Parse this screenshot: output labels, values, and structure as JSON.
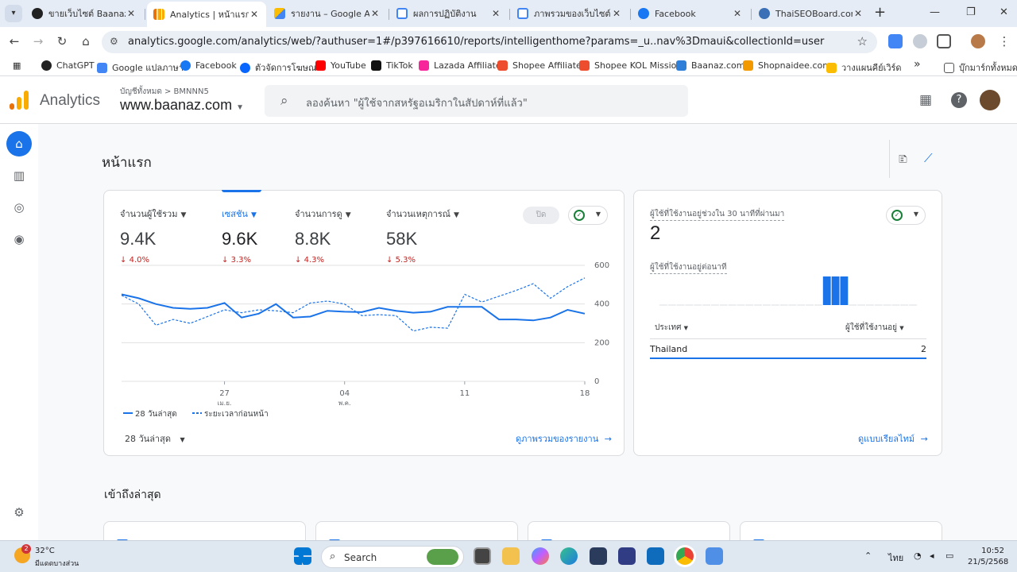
{
  "browser": {
    "tabs": [
      {
        "title": "ขายเว็บไซต์ Baanaz.com",
        "favicon_color": "#222222"
      },
      {
        "title": "Analytics | หน้าแรก",
        "favicon_color": "#f9ab00"
      },
      {
        "title": "รายงาน – Google AdSense",
        "favicon_color": "#fbbc04"
      },
      {
        "title": "ผลการปฏิบัติงาน",
        "favicon_color": "#4285f4"
      },
      {
        "title": "ภาพรวมของเว็บไซต์",
        "favicon_color": "#4285f4"
      },
      {
        "title": "Facebook",
        "favicon_color": "#1877f2"
      },
      {
        "title": "ThaiSEOBoard.com – ",
        "favicon_color": "#3b6fb6"
      }
    ],
    "close_glyph": "✕",
    "new_tab_glyph": "+",
    "url": "analytics.google.com/analytics/web/?authuser=1#/p397616610/reports/intelligenthome?params=_u..nav%3Dmaui&collectionId=user",
    "bookmarks": [
      {
        "label": "ChatGPT",
        "color": "#222222"
      },
      {
        "label": "Google แปลภาษา",
        "color": "#4285f4"
      },
      {
        "label": "Facebook",
        "color": "#1877f2"
      },
      {
        "label": "ตัวจัดการโฆษณา",
        "color": "#0866ff"
      },
      {
        "label": "YouTube",
        "color": "#ff0000"
      },
      {
        "label": "TikTok",
        "color": "#111111"
      },
      {
        "label": "Lazada Affiliate",
        "color": "#f7269a"
      },
      {
        "label": "Shopee Affiliate",
        "color": "#ee4d2d"
      },
      {
        "label": "Shopee KOL Mission",
        "color": "#ee4d2d"
      },
      {
        "label": "Baanaz.com",
        "color": "#2f7fd8"
      },
      {
        "label": "Shopnaidee.com",
        "color": "#f29900"
      },
      {
        "label": "วางแผนคีย์เวิร์ด",
        "color": "#fbbc04"
      }
    ],
    "bookmarks_more": "»",
    "all_bookmarks": "บุ๊กมาร์กทั้งหมด"
  },
  "ga": {
    "product_name": "Analytics",
    "account_crumb": "บัญชีทั้งหมด > BMNNN5",
    "property_name": "www.baanaz.com",
    "search_placeholder": "ลองค้นหา \"ผู้ใช้จากสหรัฐอเมริกาในสัปดาห์ที่แล้ว\"",
    "page_title": "หน้าแรก",
    "metrics": [
      {
        "label": "จำนวนผู้ใช้รวม",
        "value": "9.4K",
        "delta": "4.0%",
        "active": false
      },
      {
        "label": "เซสชัน",
        "value": "9.6K",
        "delta": "3.3%",
        "active": true
      },
      {
        "label": "จำนวนการดู",
        "value": "8.8K",
        "delta": "4.3%",
        "active": false
      },
      {
        "label": "จำนวนเหตุการณ์",
        "value": "58K",
        "delta": "5.3%",
        "active": false
      }
    ],
    "delta_arrow": "↓",
    "off_chip": "ปิด",
    "date_range": "28 วันล่าสุด",
    "view_overview_link": "ดูภาพรวมของรายงาน",
    "realtime": {
      "title": "ผู้ใช้ที่ใช้งานอยู่ช่วงใน 30 นาทีที่ผ่านมา",
      "value": "2",
      "per_minute_label": "ผู้ใช้ที่ใช้งานอยู่ต่อนาที",
      "minute_counts": [
        0,
        0,
        0,
        0,
        0,
        0,
        0,
        0,
        0,
        0,
        0,
        0,
        0,
        0,
        0,
        0,
        0,
        0,
        0,
        1,
        1,
        1,
        0,
        0,
        0,
        0,
        0,
        0,
        0,
        0
      ],
      "col_country": "ประเทศ",
      "col_users": "ผู้ใช้ที่ใช้งานอยู่",
      "rows": [
        {
          "country": "Thailand",
          "users": "2"
        }
      ],
      "link": "ดูแบบเรียลไทม์"
    },
    "recent_title": "เข้าถึงล่าสุด"
  },
  "chart_data": {
    "type": "line",
    "x_tick_labels": [
      {
        "day": "27",
        "month": "เม.ย."
      },
      {
        "day": "04",
        "month": "พ.ค."
      },
      {
        "day": "11",
        "month": ""
      },
      {
        "day": "18",
        "month": ""
      }
    ],
    "x_tick_index": [
      6,
      13,
      20,
      27
    ],
    "ylim": [
      0,
      600
    ],
    "y_ticks": [
      "0",
      "200",
      "400",
      "600"
    ],
    "series": [
      {
        "name": "28 วันล่าสุด",
        "style": "solid",
        "color": "#1a73e8",
        "values": [
          450,
          430,
          400,
          380,
          375,
          380,
          405,
          330,
          350,
          400,
          330,
          335,
          365,
          360,
          358,
          380,
          365,
          355,
          360,
          385,
          385,
          385,
          320,
          320,
          315,
          330,
          370,
          350
        ]
      },
      {
        "name": "ระยะเวลาก่อนหน้า",
        "style": "dashed",
        "color": "#1a73e8",
        "values": [
          445,
          400,
          290,
          320,
          300,
          335,
          370,
          355,
          370,
          365,
          355,
          405,
          415,
          400,
          340,
          345,
          340,
          260,
          280,
          275,
          450,
          410,
          440,
          470,
          505,
          430,
          490,
          535
        ]
      }
    ]
  },
  "taskbar": {
    "temp": "32°C",
    "condition": "มีแดดบางส่วน",
    "badge": "2",
    "search": "Search",
    "lang": "ไทย",
    "time": "10:52",
    "date": "21/5/2568"
  }
}
